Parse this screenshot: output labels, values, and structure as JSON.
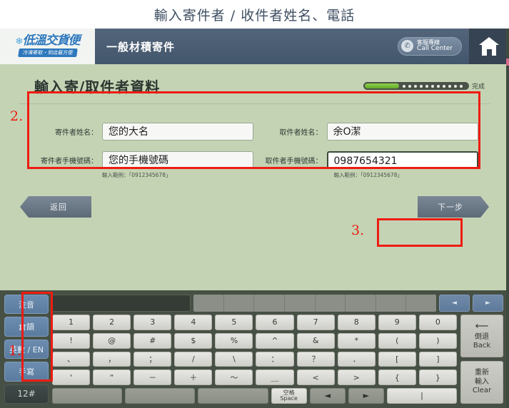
{
  "caption": "輸入寄件者 / 收件者姓名、電話",
  "appbar": {
    "logo_main": "低溫交貨便",
    "logo_flake": "❄",
    "logo_sub": "冷凍寄取・到店最方便",
    "title": "一般材積寄件",
    "callcenter_zh": "客服專線",
    "callcenter_en": "Call Center",
    "phone_icon": "phone-icon",
    "home_icon": "home-icon"
  },
  "page": {
    "title": "輸入寄/取件者資料",
    "progress_label": "完成",
    "progress_percent": 32,
    "progress_dots": 11
  },
  "form": {
    "sender_name_label": "寄件者姓名：",
    "sender_name_value": "您的大名",
    "receiver_name_label": "取件者姓名：",
    "receiver_name_value": "余O潔",
    "sender_phone_label": "寄件者手機號碼：",
    "sender_phone_value": "您的手機號碼",
    "receiver_phone_label": "取件者手機號碼：",
    "receiver_phone_value": "0987654321",
    "sender_phone_hint": "輸入範例：「0912345678」",
    "receiver_phone_hint": "輸入範例：「0912345678」"
  },
  "nav": {
    "back_label": "返回",
    "next_label": "下一步"
  },
  "annotations": {
    "ime": "1.",
    "form": "2.",
    "next": "3.",
    "color": "#ee1c12"
  },
  "keyboard": {
    "ime_keys": [
      "注音",
      "倉頡",
      "英數 / EN",
      "手寫"
    ],
    "ime_num_key": "12#",
    "composing_value": "",
    "candidate_cells": 8,
    "cand_prev": "◄",
    "cand_next": "►",
    "rows": [
      [
        "1",
        "2",
        "3",
        "4",
        "5",
        "6",
        "7",
        "8",
        "9",
        "0"
      ],
      [
        "!",
        "@",
        "#",
        "$",
        "%",
        "^",
        "&",
        "*",
        "(",
        ")"
      ],
      [
        "、",
        "，",
        "；",
        "/",
        "\\",
        "：",
        "？",
        "．",
        "[",
        "]"
      ],
      [
        "'",
        "“",
        "－",
        "＋",
        "～",
        "＿",
        "<",
        ">",
        "{",
        "}"
      ]
    ],
    "bottom_row": {
      "blank_keys": 3,
      "space_zh": "空格",
      "space_en": "Space",
      "left_arrow": "◄",
      "right_arrow": "►",
      "pipe": "|"
    },
    "side_keys": [
      {
        "glyph": "⟵",
        "zh": "倒退",
        "en": "Back"
      },
      {
        "zh1": "重新",
        "zh2": "輸入",
        "en": "Clear"
      }
    ]
  }
}
